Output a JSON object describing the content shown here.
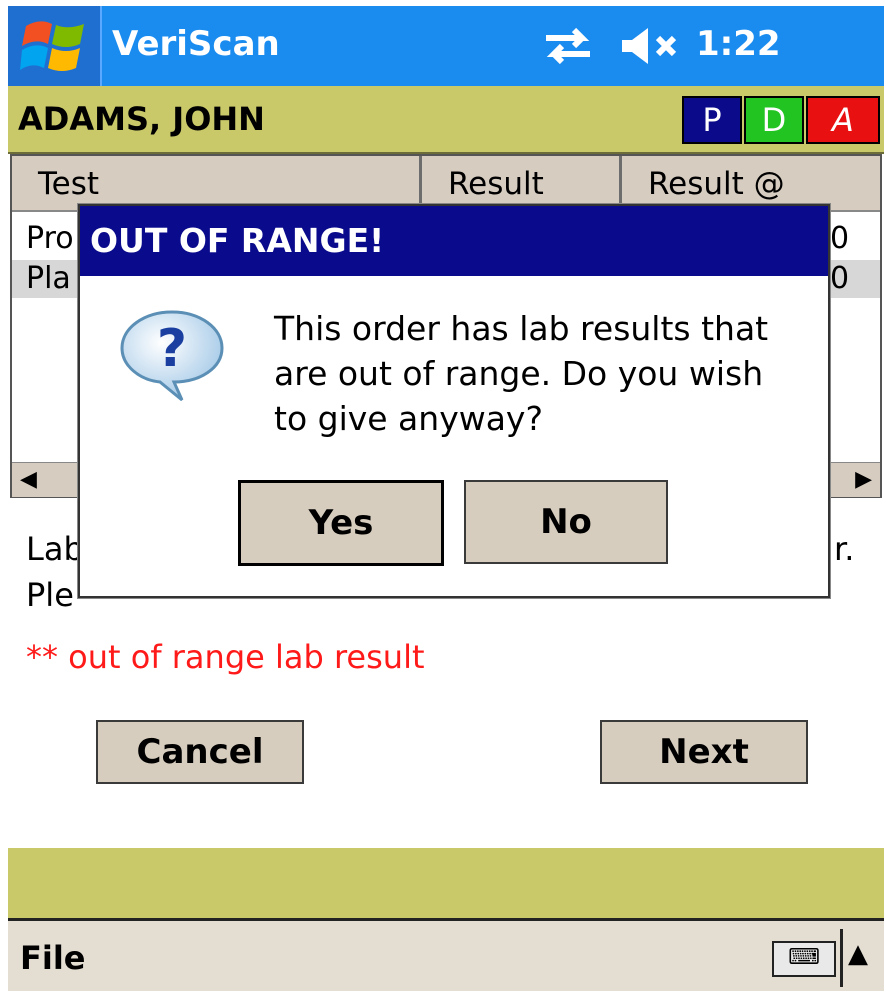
{
  "titlebar": {
    "app_title": "VeriScan",
    "time": "1:22",
    "icons": [
      "start-menu-icon",
      "connectivity-icon",
      "speaker-muted-icon"
    ]
  },
  "patient": {
    "name": "ADAMS, JOHN",
    "flags": [
      "P",
      "D",
      "A"
    ]
  },
  "grid": {
    "columns": [
      "Test",
      "Result",
      "Result @"
    ],
    "rows": [
      {
        "test": "Pro",
        "result_at": "0"
      },
      {
        "test": "Pla",
        "result_at": "0"
      }
    ]
  },
  "body": {
    "line1_start": "Lab",
    "line1_end": "r.",
    "line2_start": "Ple",
    "warning": "** out of range lab result"
  },
  "buttons": {
    "cancel": "Cancel",
    "next": "Next"
  },
  "menu": {
    "file": "File"
  },
  "dialog": {
    "title": "OUT OF RANGE!",
    "message": "This order has lab results that are out of range. Do you wish to give anyway?",
    "yes": "Yes",
    "no": "No",
    "icon": "question-icon"
  },
  "colors": {
    "titlebar": "#1a8cf0",
    "olive": "#c9c96a",
    "dialog_title": "#0a0a8c",
    "warning": "#ff1a1a"
  }
}
